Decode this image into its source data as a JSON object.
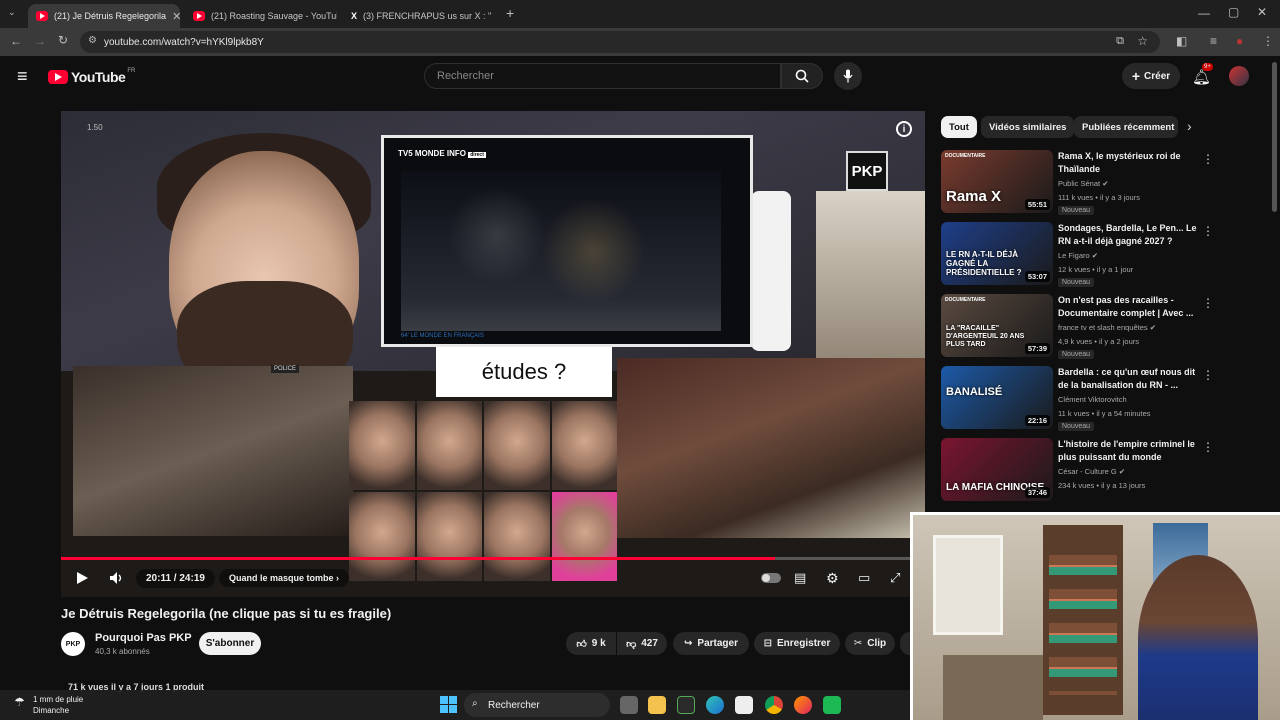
{
  "browser": {
    "tabs": [
      {
        "label": "(21) Je Détruis Regelegorila",
        "active": true
      },
      {
        "label": "(21) Roasting Sauvage - YouTub",
        "active": false
      },
      {
        "label": "(3) FRENCHRAPUS us sur X : \"",
        "active": false
      }
    ],
    "new_tab": "+",
    "url": "youtube.com/watch?v=hYKl9lpkb8Y"
  },
  "youtube": {
    "logo": "YouTube",
    "region": "FR",
    "search_placeholder": "Rechercher",
    "create_label": "Créer",
    "notif_count": "9+"
  },
  "player": {
    "corner_number": "1.50",
    "tv_logo": "TV5 MONDE INFO",
    "tv_live": "direct",
    "tv_footer": "64' LE MONDE EN FRANÇAIS",
    "pkp_logo": "PKP",
    "overlay_text": "études ?",
    "police_label": "POLICE",
    "time": "20:11 / 24:19",
    "chapter": "Quand le masque tombe",
    "progress_fraction": 0.826
  },
  "video": {
    "title": "Je Détruis Regelegorila (ne clique pas si tu es fragile)",
    "channel_name": "Pourquoi Pas PKP",
    "channel_avatar": "PKP",
    "subscribers": "40,3 k abonnés",
    "subscribe_label": "S'abonner",
    "likes": "9 k",
    "dislikes": "427",
    "share_label": "Partager",
    "save_label": "Enregistrer",
    "clip_label": "Clip",
    "views_line": "71 k vues  il y a 7 jours  1 produit"
  },
  "sidebar": {
    "chips": [
      "Tout",
      "Vidéos similaires",
      "Publiées récemment"
    ],
    "items": [
      {
        "title": "Rama X, le mystérieux roi de Thaïlande",
        "channel": "Public Sénat",
        "meta": "111 k vues • il y a 3 jours",
        "badge": "Nouveau",
        "duration": "55:51",
        "thumb_text": "Rama X",
        "thumb_tag": "DOCUMENTAIRE",
        "color": "#7a3b2e"
      },
      {
        "title": "Sondages, Bardella, Le Pen... Le RN a-t-il déjà gagné 2027 ?",
        "channel": "Le Figaro",
        "meta": "12 k vues • il y a 1 jour",
        "badge": "Nouveau",
        "duration": "53:07",
        "thumb_text": "LE RN A-T-IL DÉJÀ GAGNÉ LA PRÉSIDENTIELLE ?",
        "color": "#1f3f8a"
      },
      {
        "title": "On n'est pas des racailles - Documentaire complet | Avec ...",
        "channel": "france tv et slash enquêtes",
        "meta": "4,9 k vues • il y a 2 jours",
        "badge": "Nouveau",
        "duration": "57:39",
        "thumb_text": "LA \"RACAILLE\" D'ARGENTEUIL 20 ANS PLUS TARD",
        "thumb_tag": "DOCUMENTAIRE",
        "color": "#5a4a40"
      },
      {
        "title": "Bardella : ce qu'un œuf nous dit de la banalisation du RN - ...",
        "channel": "Clément Viktorovitch",
        "meta": "11 k vues • il y a 54 minutes",
        "badge": "Nouveau",
        "duration": "22:16",
        "thumb_text": "BANALISÉ",
        "color": "#1c5aa8"
      },
      {
        "title": "L'histoire de l'empire criminel le plus puissant du monde",
        "channel": "César - Culture G",
        "meta": "234 k vues • il y a 13 jours",
        "badge": "",
        "duration": "37:46",
        "thumb_text": "LA MAFIA CHINOISE",
        "color": "#7a1530"
      }
    ]
  },
  "taskbar": {
    "weather": "1 mm de pluie",
    "day": "Dimanche",
    "search": "Rechercher"
  },
  "colors": {
    "brand": "#ff0033",
    "background": "#0f0f0f"
  }
}
